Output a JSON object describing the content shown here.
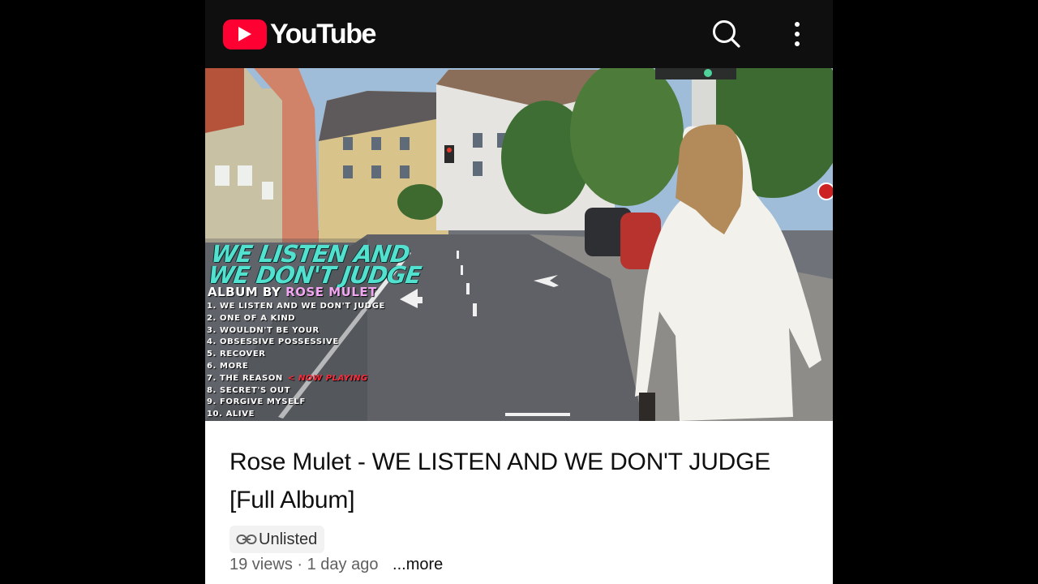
{
  "app": {
    "name": "YouTube",
    "accent_color": "#ff0033",
    "header_bg": "#0f0f0f"
  },
  "header": {
    "logo_text": "YouTube",
    "search_icon": "search-icon",
    "more_icon": "more-vertical-icon"
  },
  "video": {
    "overlay_title_line1": "WE LISTEN AND",
    "overlay_title_line2": "WE DON'T JUDGE",
    "album_by_prefix": "ALBUM BY",
    "album_artist": "ROSE MULET",
    "now_playing_label": "< NOW PLAYING",
    "now_playing_index": 6,
    "tracks": [
      "1. WE LISTEN AND WE DON'T JUDGE",
      "2. ONE OF A KIND",
      "3. WOULDN'T BE YOUR",
      "4. OBSESSIVE POSSESSIVE",
      "5. RECOVER",
      "6. MORE",
      "7. THE REASON",
      "8. SECRET'S OUT",
      "9. FORGIVE MYSELF",
      "10. ALIVE"
    ]
  },
  "details": {
    "title": "Rose Mulet - WE LISTEN AND WE DON'T JUDGE [Full Album]",
    "visibility_badge": "Unlisted",
    "visibility_icon": "link-icon",
    "views": "19 views",
    "separator": "·",
    "uploaded": "1 day ago",
    "more_label": "...more"
  }
}
